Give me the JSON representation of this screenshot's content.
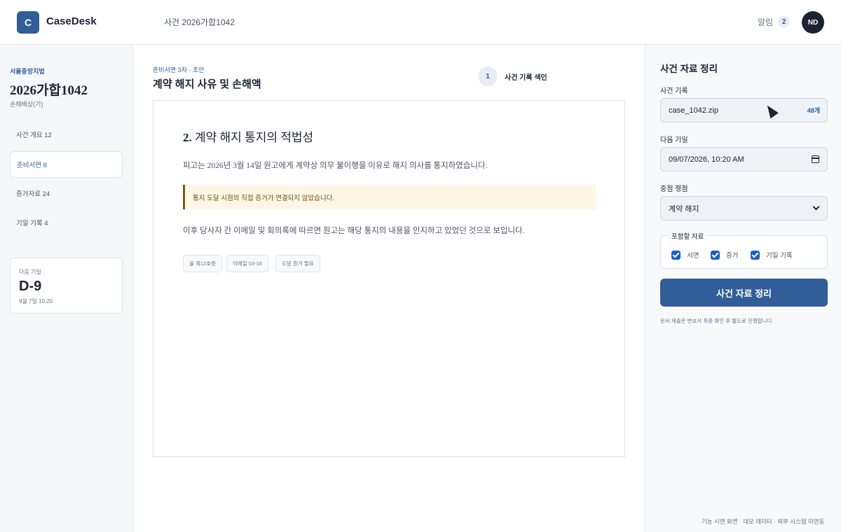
{
  "header": {
    "logo_letter": "C",
    "brand": "CaseDesk",
    "case_ref": "사건 2026가합1042",
    "notifications_label": "알림",
    "notifications_count": "2",
    "avatar_initials": "ND"
  },
  "sidebar": {
    "court": "서울중앙지법",
    "case_number": "2026가합1042",
    "case_type": "손해배상(기)",
    "items": [
      {
        "label": "사건 개요 12",
        "active": false
      },
      {
        "label": "준비서면 8",
        "active": true
      },
      {
        "label": "증거자료 24",
        "active": false
      },
      {
        "label": "기일 기록 4",
        "active": false
      }
    ],
    "deadline": {
      "label": "다음 기일",
      "value": "D-9",
      "date": "9월 7일 10:20"
    }
  },
  "main": {
    "subtitle": "준비서면 3차 · 초안",
    "title": "계약 해지 사유 및 손해액",
    "step": {
      "number": "1",
      "label": "사건 기록 색인"
    },
    "document": {
      "section_number": "2.",
      "section_title": "계약 해지 통지의 적법성",
      "para1": "피고는 2026년 3월 14일 원고에게 계약상 의무 불이행을 이유로 해지 의사를 통지하였습니다.",
      "alert": "통지 도달 시점의 직접 증거가 연결되지 않았습니다.",
      "para2": "이후 당사자 간 이메일 및 회의록에 따르면 원고는 해당 통지의 내용을 인지하고 있었던 것으로 보입니다.",
      "tags": [
        "을 제12호증",
        "이메일 03-15",
        "도달 증거 필요"
      ]
    }
  },
  "right_panel": {
    "title": "사건 자료 정리",
    "record_label": "사건 기록",
    "record_file": "case_1042.zip",
    "record_count": "48개",
    "date_label": "다음 기일",
    "date_value": "09/07/2026, 10:20 AM",
    "issue_label": "중점 쟁점",
    "issue_value": "계약 해지",
    "include_legend": "포함할 자료",
    "include_options": [
      {
        "label": "서면",
        "checked": true
      },
      {
        "label": "증거",
        "checked": true
      },
      {
        "label": "기일 기록",
        "checked": true
      }
    ],
    "primary_button": "사건 자료 정리",
    "note": "문서 제출은 변호사 최종 확인 후 별도로 진행합니다."
  },
  "footer": {
    "note": "기능 시연 화면 · 데모 데이터 · 외부 시스템 미연동"
  },
  "colors": {
    "accent": "#315d98",
    "alert_bg": "#fff6e5",
    "alert_border": "#7a5a1a",
    "checkbox": "#1a5fc7"
  }
}
